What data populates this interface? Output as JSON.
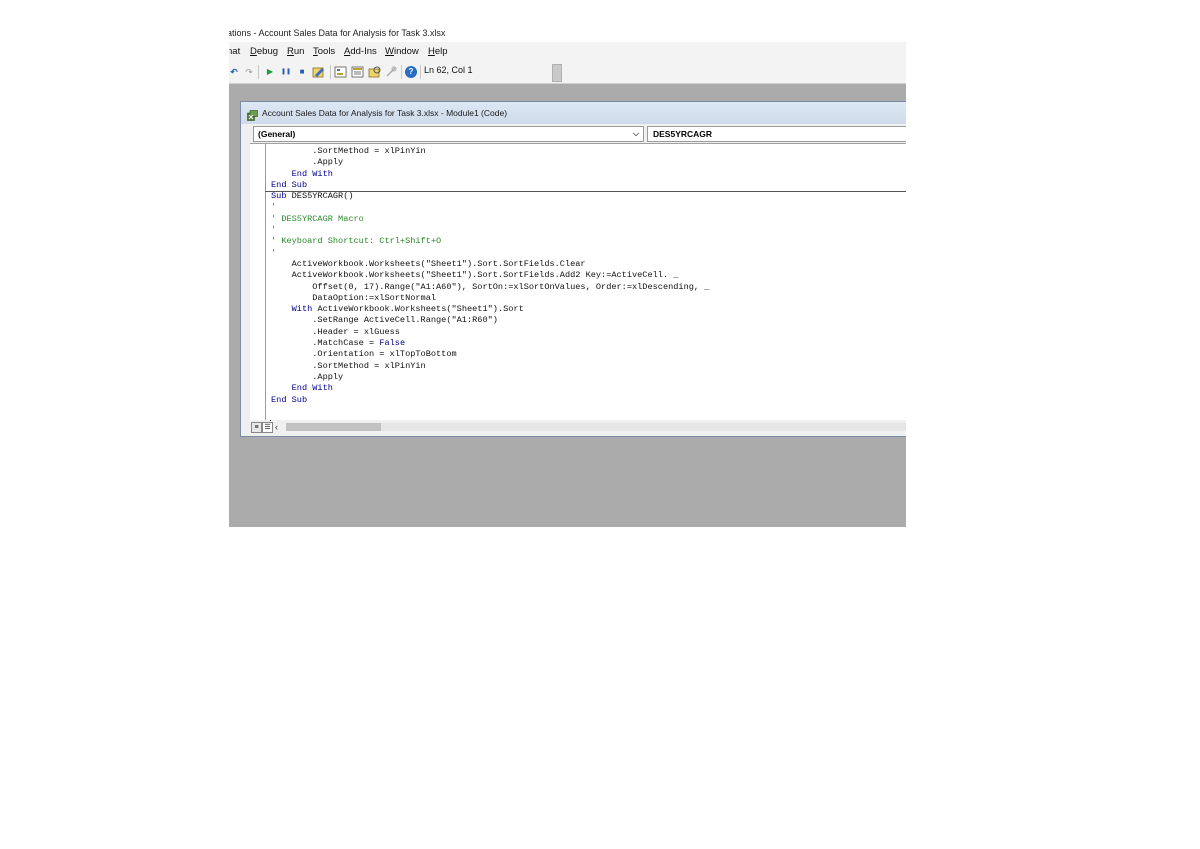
{
  "app": {
    "title": "ations - Account Sales Data for Analysis for Task 3.xlsx"
  },
  "menu": [
    {
      "label": "nat",
      "key": ""
    },
    {
      "label": "Debug",
      "key": "D"
    },
    {
      "label": "Run",
      "key": "R"
    },
    {
      "label": "Tools",
      "key": "T"
    },
    {
      "label": "Add-Ins",
      "key": "A"
    },
    {
      "label": "Window",
      "key": "W"
    },
    {
      "label": "Help",
      "key": "H"
    }
  ],
  "toolbar": {
    "position": "Ln 62, Col 1",
    "undo": "↶",
    "redo": "↷",
    "run": "▶",
    "break": "❚❚",
    "reset": "■",
    "help": "?"
  },
  "code_window": {
    "title": "Account Sales Data for Analysis for Task 3.xlsx - Module1 (Code)",
    "object_dropdown": "(General)",
    "procedure_dropdown": "DES5YRCAGR",
    "chevron": "⌵",
    "scroll_left": "‹",
    "view_proc": "≡",
    "view_full": "☰"
  },
  "code_lines": [
    "        .SortMethod = xlPinYin",
    "        .Apply",
    "    End With",
    "End Sub",
    "Sub DES5YRCAGR()",
    "'",
    "' DES5YRCAGR Macro",
    "'",
    "' Keyboard Shortcut: Ctrl+Shift+O",
    "'",
    "    ActiveWorkbook.Worksheets(\"Sheet1\").Sort.SortFields.Clear",
    "    ActiveWorkbook.Worksheets(\"Sheet1\").Sort.SortFields.Add2 Key:=ActiveCell. _",
    "        Offset(0, 17).Range(\"A1:A60\"), SortOn:=xlSortOnValues, Order:=xlDescending, _",
    "        DataOption:=xlSortNormal",
    "    With ActiveWorkbook.Worksheets(\"Sheet1\").Sort",
    "        .SetRange ActiveCell.Range(\"A1:R60\")",
    "        .Header = xlGuess",
    "        .MatchCase = False",
    "        .Orientation = xlTopToBottom",
    "        .SortMethod = xlPinYin",
    "        .Apply",
    "    End With",
    "End Sub"
  ],
  "colors": {
    "keyword": "#00008b",
    "comment": "#2a8a2a",
    "text": "#111111",
    "workspace": "#ababab"
  }
}
